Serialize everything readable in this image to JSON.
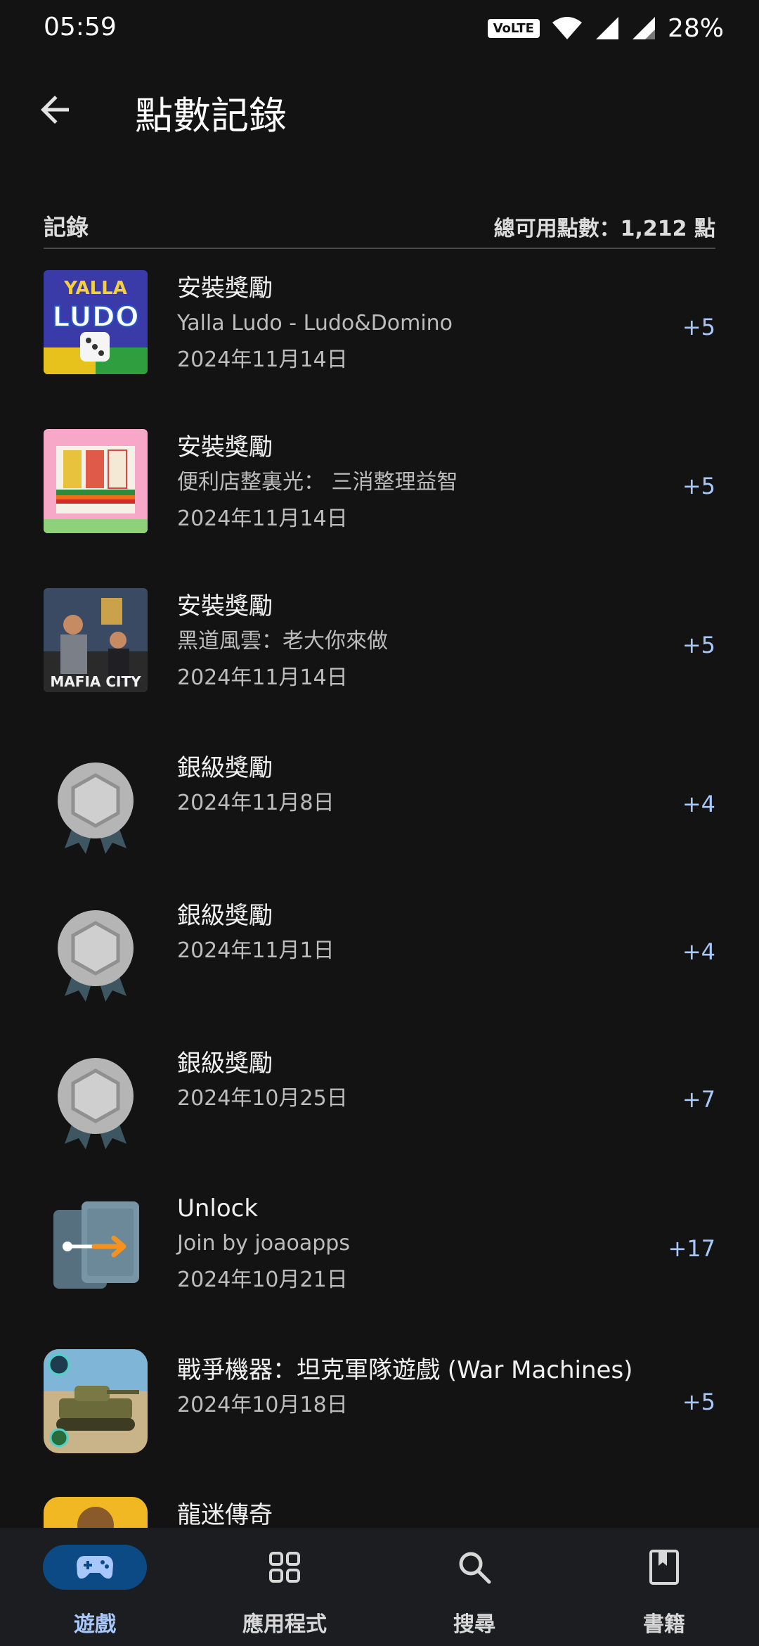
{
  "status_bar": {
    "time": "05:59",
    "volte": "VoLTE",
    "battery": "28%"
  },
  "header": {
    "title": "點數記錄"
  },
  "section": {
    "label": "記錄",
    "total": "總可用點數：1,212 點"
  },
  "records": [
    {
      "title": "安裝獎勵",
      "subtitle": "Yalla Ludo - Ludo&Domino",
      "date": "2024年11月14日",
      "points": "+5",
      "icon": "yalla-ludo-app-icon"
    },
    {
      "title": "安裝獎勵",
      "subtitle": "便利店整裏光： 三消整理益智",
      "date": "2024年11月14日",
      "points": "+5",
      "icon": "convenience-store-app-icon"
    },
    {
      "title": "安裝獎勵",
      "subtitle": "黑道風雲：老大你來做",
      "date": "2024年11月14日",
      "points": "+5",
      "icon": "mafia-city-app-icon"
    },
    {
      "title": "銀級獎勵",
      "date": "2024年11月8日",
      "points": "+4",
      "icon": "silver-medal-icon"
    },
    {
      "title": "銀級獎勵",
      "date": "2024年11月1日",
      "points": "+4",
      "icon": "silver-medal-icon"
    },
    {
      "title": "銀級獎勵",
      "date": "2024年10月25日",
      "points": "+7",
      "icon": "silver-medal-icon"
    },
    {
      "title": "Unlock",
      "subtitle": "Join by joaoapps",
      "date": "2024年10月21日",
      "points": "+17",
      "icon": "unlock-app-icon"
    },
    {
      "title": "戰爭機器：坦克軍隊遊戲 (War Machines)",
      "date": "2024年10月18日",
      "points": "+5",
      "icon": "war-machines-app-icon"
    },
    {
      "title": "龍迷傳奇",
      "icon": "dragon-game-app-icon"
    }
  ],
  "nav": {
    "games": "遊戲",
    "apps": "應用程式",
    "search": "搜尋",
    "books": "書籍",
    "active": "games"
  },
  "colors": {
    "background": "#131313",
    "accent": "#a8c7fa",
    "nav_active_pill": "#0c4a86"
  }
}
